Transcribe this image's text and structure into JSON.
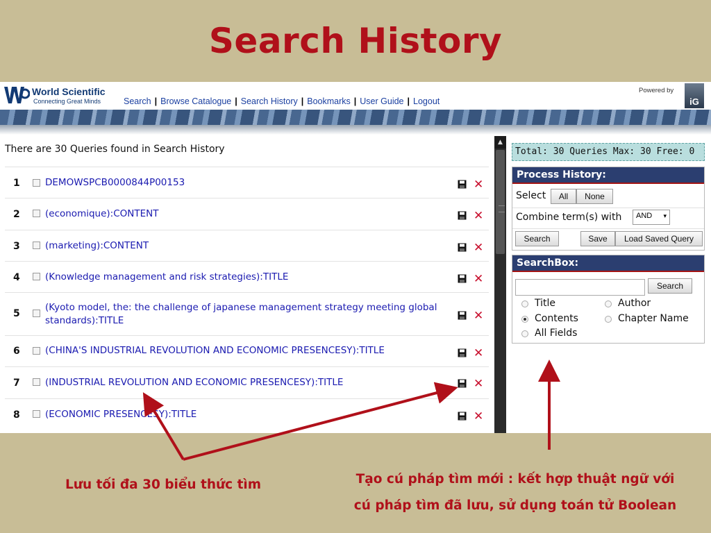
{
  "slide": {
    "title": "Search History",
    "note_left": "Lưu tối đa 30 biểu thức tìm",
    "note_right_line1": "Tạo cú pháp tìm mới : kết hợp thuật ngữ với",
    "note_right_line2": "cú pháp tìm đã lưu, sử dụng toán tử Boolean"
  },
  "header": {
    "brand_name": "World Scientific",
    "brand_tagline": "Connecting Great Minds",
    "nav": [
      "Search",
      "Browse Catalogue",
      "Search History",
      "Bookmarks",
      "User Guide",
      "Logout"
    ],
    "powered_by": "Powered by",
    "powered_logo": "iG"
  },
  "history": {
    "found_text": "There are 30 Queries found in Search History",
    "rows": [
      {
        "num": "1",
        "query": "DEMOWSPCB0000844P00153"
      },
      {
        "num": "2",
        "query": "(economique):CONTENT"
      },
      {
        "num": "3",
        "query": "(marketing):CONTENT"
      },
      {
        "num": "4",
        "query": "(Knowledge management and risk strategies):TITLE"
      },
      {
        "num": "5",
        "query": "(Kyoto model, the: the challenge of japanese management strategy meeting global standards):TITLE"
      },
      {
        "num": "6",
        "query": "(CHINA'S INDUSTRIAL REVOLUTION AND ECONOMIC PRESENCESY):TITLE"
      },
      {
        "num": "7",
        "query": "(INDUSTRIAL REVOLUTION AND ECONOMIC PRESENCESY):TITLE"
      },
      {
        "num": "8",
        "query": "(ECONOMIC PRESENCESY):TITLE"
      }
    ]
  },
  "sidebar": {
    "total_text": "Total: 30 Queries Max: 30 Free: 0",
    "process": {
      "title": "Process History:",
      "select_label": "Select",
      "all_label": "All",
      "none_label": "None",
      "combine_label": "Combine term(s) with",
      "operator": "AND",
      "search_label": "Search",
      "save_label": "Save",
      "load_label": "Load Saved Query"
    },
    "searchbox": {
      "title": "SearchBox:",
      "input_value": "",
      "search_label": "Search",
      "options": [
        "Title",
        "Author",
        "Contents",
        "Chapter Name",
        "All Fields"
      ],
      "selected": "Contents"
    }
  },
  "colors": {
    "slide_bg": "#c8bd96",
    "accent_red": "#b0101a",
    "link_blue": "#1a1ab0",
    "panel_navy": "#2b3e70",
    "total_bg": "#b9dede"
  }
}
